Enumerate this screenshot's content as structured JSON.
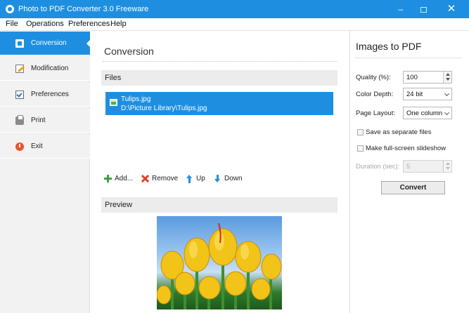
{
  "window": {
    "title": "Photo to PDF Converter 3.0 Freeware",
    "minimize": "–",
    "close": "✕"
  },
  "menu": [
    "File",
    "Operations",
    "Preferences",
    "Help"
  ],
  "sidebar": {
    "items": [
      {
        "label": "Conversion",
        "icon": "conversion-icon",
        "active": true
      },
      {
        "label": "Modification",
        "icon": "pencil-icon"
      },
      {
        "label": "Preferences",
        "icon": "preferences-icon"
      },
      {
        "label": "Print",
        "icon": "printer-icon"
      },
      {
        "label": "Exit",
        "icon": "power-icon"
      }
    ]
  },
  "main": {
    "title": "Conversion",
    "files_header": "Files",
    "files": [
      {
        "name": "Tulips.jpg",
        "path": "D:\\Picture Library\\Tulips.jpg"
      }
    ],
    "toolbar": {
      "add": "Add...",
      "remove": "Remove",
      "up": "Up",
      "down": "Down"
    },
    "preview_header": "Preview"
  },
  "right_panel": {
    "title": "Images to PDF",
    "quality_label": "Quality (%):",
    "quality_value": "100",
    "color_depth_label": "Color Depth:",
    "color_depth_value": "24 bit",
    "page_layout_label": "Page Layout:",
    "page_layout_value": "One column",
    "separate_files_label": "Save as separate files",
    "separate_files_checked": false,
    "slideshow_label": "Make full-screen slideshow",
    "slideshow_checked": false,
    "duration_label": "Duration (sec):",
    "duration_value": "5",
    "convert_label": "Convert"
  },
  "colors": {
    "accent": "#1e8fe0",
    "sidebar_bg": "#f2f2f2",
    "section_bg": "#ececec"
  }
}
